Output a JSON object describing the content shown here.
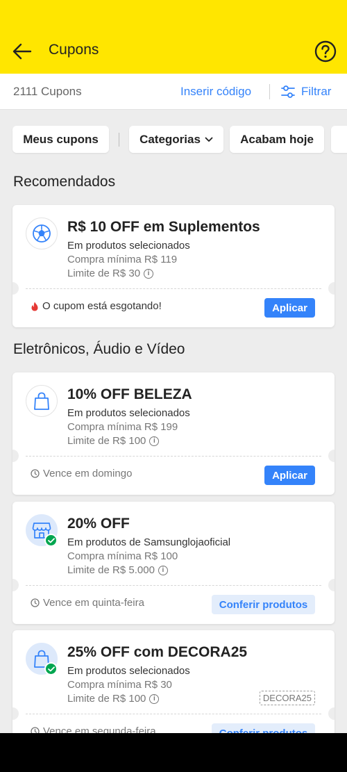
{
  "header": {
    "title": "Cupons",
    "bg_color": "#ffe600"
  },
  "subbar": {
    "count": "2111 Cupons",
    "insert_code": "Inserir código",
    "filter": "Filtrar"
  },
  "chips": [
    "Meus cupons",
    "Categorias",
    "Acabam hoje"
  ],
  "sections": {
    "recommended": "Recomendados",
    "electronics": "Eletrônicos, Áudio e Vídeo"
  },
  "coupons": [
    {
      "icon": "soccer-ball-icon",
      "title": "R$ 10 OFF em Suplementos",
      "subtitle": "Em produtos selecionados",
      "min": "Compra mínima R$ 119",
      "limit": "Limite de R$ 30",
      "footer": "O cupom está esgotando!",
      "action": "Aplicar"
    },
    {
      "icon": "shopping-bag-icon",
      "title": "10% OFF BELEZA",
      "subtitle": "Em produtos selecionados",
      "min": "Compra mínima R$ 199",
      "limit": "Limite de R$ 100",
      "footer": "Vence em domingo",
      "action": "Aplicar"
    },
    {
      "icon": "store-icon",
      "title": "20% OFF",
      "subtitle": "Em produtos de Samsunglojaoficial",
      "min": "Compra mínima R$ 100",
      "limit": "Limite de R$ 5.000",
      "footer": "Vence em quinta-feira",
      "action": "Conferir produtos"
    },
    {
      "icon": "shopping-bag-icon",
      "title": "25% OFF com DECORA25",
      "subtitle": "Em produtos selecionados",
      "min": "Compra mínima R$ 30",
      "limit": "Limite de R$ 100",
      "code": "DECORA25",
      "footer": "Vence em segunda-feira",
      "action": "Conferir produtos"
    }
  ],
  "colors": {
    "accent": "#3483fa",
    "success": "#00a650",
    "hot": "#e53935"
  }
}
